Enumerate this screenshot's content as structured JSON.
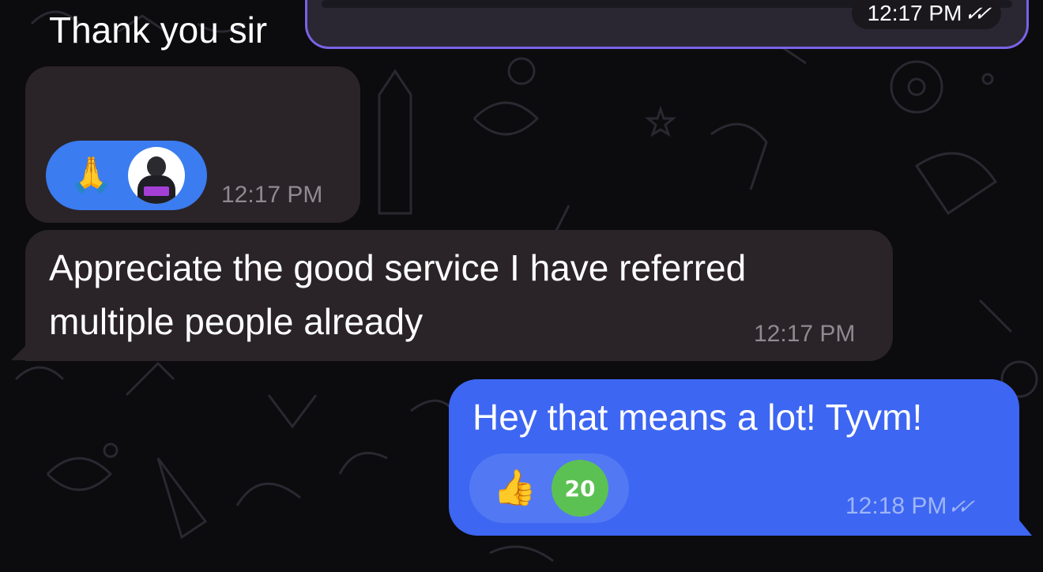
{
  "messages": [
    {
      "direction": "outgoing",
      "time": "12:17 PM",
      "read_icon": "double-check-icon"
    },
    {
      "direction": "incoming",
      "text": "Thank you sir",
      "time": "12:17 PM",
      "reaction": {
        "emoji": "🙏",
        "icon": "folded-hands-icon",
        "reactor": "avatar"
      }
    },
    {
      "direction": "incoming",
      "text_lines": [
        "Appreciate the good service I have referred",
        "multiple people already"
      ],
      "time": "12:17 PM"
    },
    {
      "direction": "outgoing",
      "text": "Hey that means a lot! Tyvm!",
      "time": "12:18 PM",
      "read_icon": "double-check-icon",
      "reaction": {
        "emoji": "👍",
        "icon": "thumbs-up-icon",
        "badge": "20"
      }
    }
  ],
  "colors": {
    "background": "#0c0b0e",
    "incoming_bubble": "#2a2428",
    "outgoing_bubble": "#3d66f2",
    "outgoing_border": "#7a63e6",
    "reaction_incoming": "#3b7cf0",
    "badge_green": "#5cc153"
  }
}
